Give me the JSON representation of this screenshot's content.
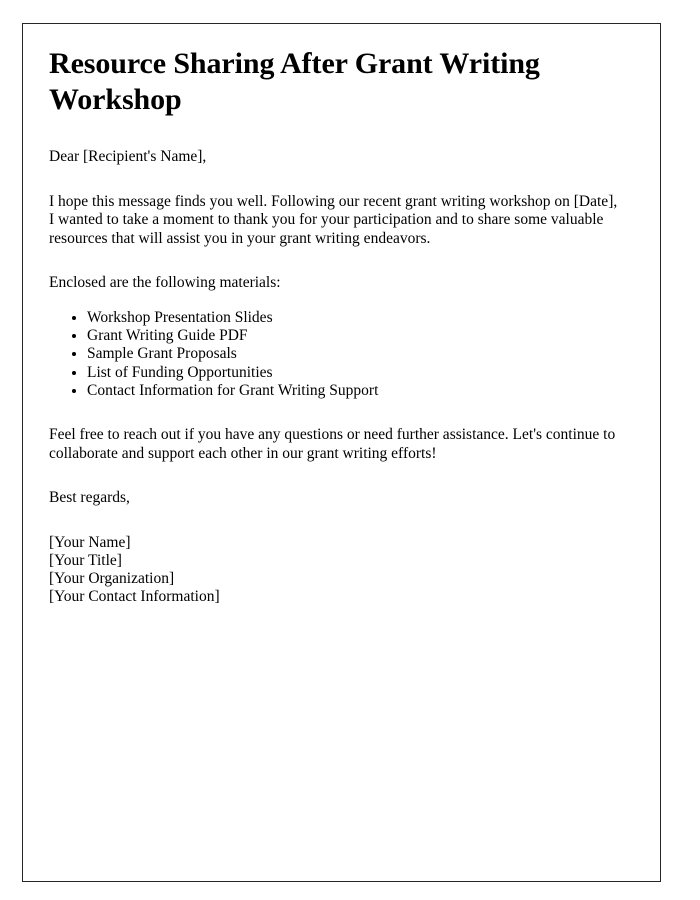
{
  "document": {
    "title": "Resource Sharing After Grant Writing Workshop",
    "salutation": "Dear [Recipient's Name],",
    "intro_paragraph": "I hope this message finds you well. Following our recent grant writing workshop on [Date], I wanted to take a moment to thank you for your participation and to share some valuable resources that will assist you in your grant writing endeavors.",
    "enclosure_intro": "Enclosed are the following materials:",
    "materials": [
      "Workshop Presentation Slides",
      "Grant Writing Guide PDF",
      "Sample Grant Proposals",
      "List of Funding Opportunities",
      "Contact Information for Grant Writing Support"
    ],
    "closing_paragraph": "Feel free to reach out if you have any questions or need further assistance. Let's continue to collaborate and support each other in our grant writing efforts!",
    "sign_off": "Best regards,",
    "signature": [
      "[Your Name]",
      "[Your Title]",
      "[Your Organization]",
      "[Your Contact Information]"
    ]
  },
  "style": {
    "page_background": "#ffffff",
    "text_color": "#000000",
    "border_color": "#262626"
  }
}
